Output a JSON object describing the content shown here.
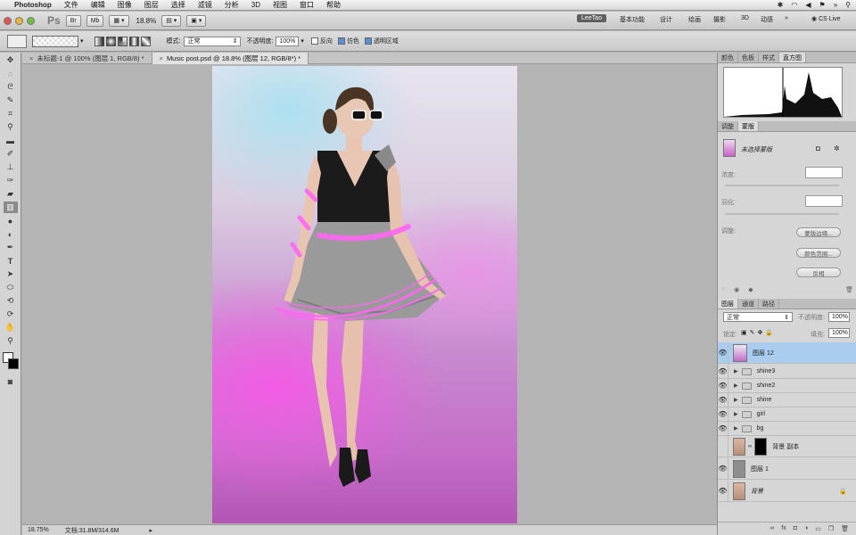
{
  "menubar": {
    "app": "Photoshop",
    "items": [
      "文件",
      "编辑",
      "图像",
      "图层",
      "选择",
      "滤镜",
      "分析",
      "3D",
      "视图",
      "窗口",
      "帮助"
    ]
  },
  "appbar": {
    "logo": "Ps",
    "zoom": "18.8%",
    "workspaces": [
      "LeeTao",
      "基本功能",
      "设计",
      "绘画",
      "摄影",
      "3D",
      "动感"
    ],
    "cslive": "CS Live"
  },
  "options": {
    "mode_label": "模式:",
    "mode_value": "正常",
    "opacity_label": "不透明度:",
    "opacity_value": "100%",
    "reverse_label": "反向",
    "dither_label": "仿色",
    "transparency_label": "透明区域"
  },
  "tabs": [
    {
      "label": "未标题-1 @ 100% (图层 1, RGB/8) *",
      "active": false
    },
    {
      "label": "Music post.psd @ 18.8% (图层 12, RGB/8*) *",
      "active": true
    }
  ],
  "status": {
    "zoom": "18.75%",
    "doc": "文档:31.8M/314.6M"
  },
  "panel_top": {
    "tabs": [
      "颜色",
      "色板",
      "样式",
      "直方图"
    ],
    "active": "直方图"
  },
  "panel_mask": {
    "tabs": [
      "调整",
      "蒙版"
    ],
    "title": "未选择蒙版",
    "density_label": "浓度:",
    "feather_label": "羽化:",
    "refine_label": "调整:",
    "btn_edge": "蒙版边缘...",
    "btn_color": "颜色范围...",
    "btn_invert": "反相"
  },
  "layers_panel": {
    "tabs": [
      "图层",
      "通道",
      "路径"
    ],
    "blend": "正常",
    "opacity_label": "不透明度:",
    "opacity_value": "100%",
    "lock_label": "锁定:",
    "fill_label": "填充:",
    "fill_value": "100%",
    "layers": [
      {
        "name": "图层 12",
        "kind": "layer",
        "selected": true
      },
      {
        "name": "shine3",
        "kind": "group"
      },
      {
        "name": "shine2",
        "kind": "group"
      },
      {
        "name": "shine",
        "kind": "group"
      },
      {
        "name": "girl",
        "kind": "group"
      },
      {
        "name": "bg",
        "kind": "group"
      },
      {
        "name": "背景 副本",
        "kind": "masked"
      },
      {
        "name": "图层 1",
        "kind": "layer"
      },
      {
        "name": "背景",
        "kind": "background"
      }
    ]
  }
}
